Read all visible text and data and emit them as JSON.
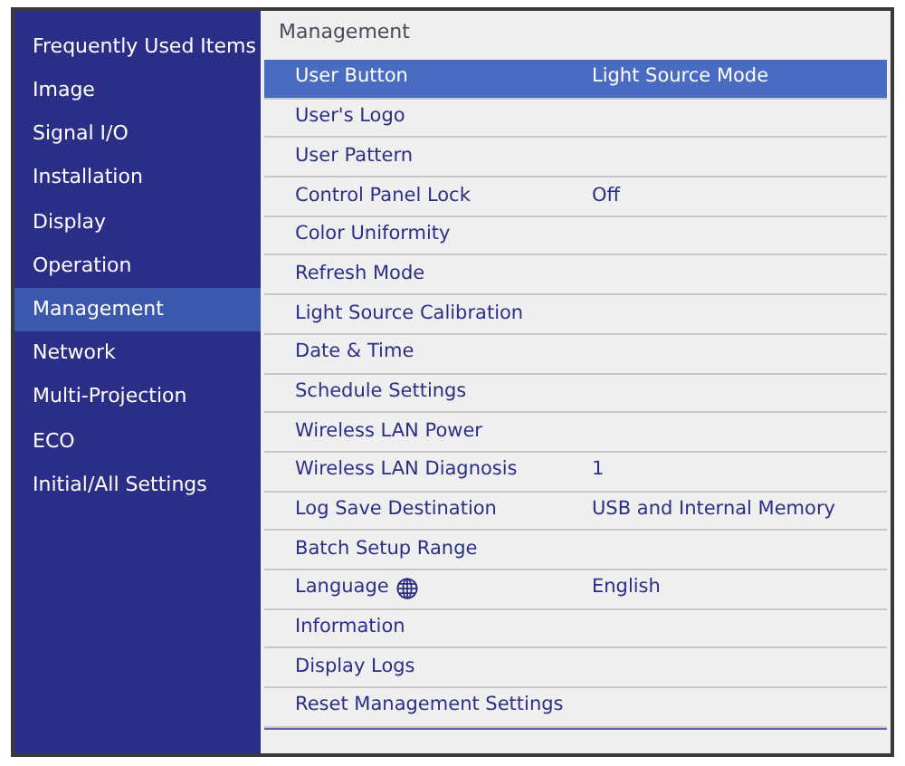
{
  "sidebar": {
    "items": [
      {
        "label": "Frequently Used Items",
        "selected": false
      },
      {
        "label": "Image",
        "selected": false
      },
      {
        "label": "Signal I/O",
        "selected": false
      },
      {
        "label": "Installation",
        "selected": false
      },
      {
        "label": "Display",
        "selected": false
      },
      {
        "label": "Operation",
        "selected": false
      },
      {
        "label": "Management",
        "selected": true
      },
      {
        "label": "Network",
        "selected": false
      },
      {
        "label": "Multi-Projection",
        "selected": false
      },
      {
        "label": "ECO",
        "selected": false
      },
      {
        "label": "Initial/All Settings",
        "selected": false
      }
    ]
  },
  "panel": {
    "title": "Management",
    "rows": [
      {
        "label": "User Button",
        "value": "Light Source Mode",
        "selected": true
      },
      {
        "label": "User's Logo",
        "selected": false
      },
      {
        "label": "User Pattern",
        "selected": false
      },
      {
        "label": "Control Panel Lock",
        "value": "Off",
        "selected": false
      },
      {
        "label": "Color Uniformity",
        "selected": false
      },
      {
        "label": "Refresh Mode",
        "selected": false
      },
      {
        "label": "Light Source Calibration",
        "selected": false
      },
      {
        "label": "Date & Time",
        "selected": false
      },
      {
        "label": "Schedule Settings",
        "selected": false
      },
      {
        "label": "Wireless LAN Power",
        "selected": false
      },
      {
        "label": "Wireless LAN Diagnosis",
        "value": "1",
        "selected": false
      },
      {
        "label": "Log Save Destination",
        "value": "USB and Internal Memory",
        "selected": false
      },
      {
        "label": "Batch Setup Range",
        "selected": false
      },
      {
        "label": "Language",
        "value": "English",
        "selected": false,
        "kind": "globe"
      },
      {
        "label": "Information",
        "selected": false
      },
      {
        "label": "Display Logs",
        "selected": false
      },
      {
        "label": "Reset Management Settings",
        "selected": false
      }
    ]
  }
}
